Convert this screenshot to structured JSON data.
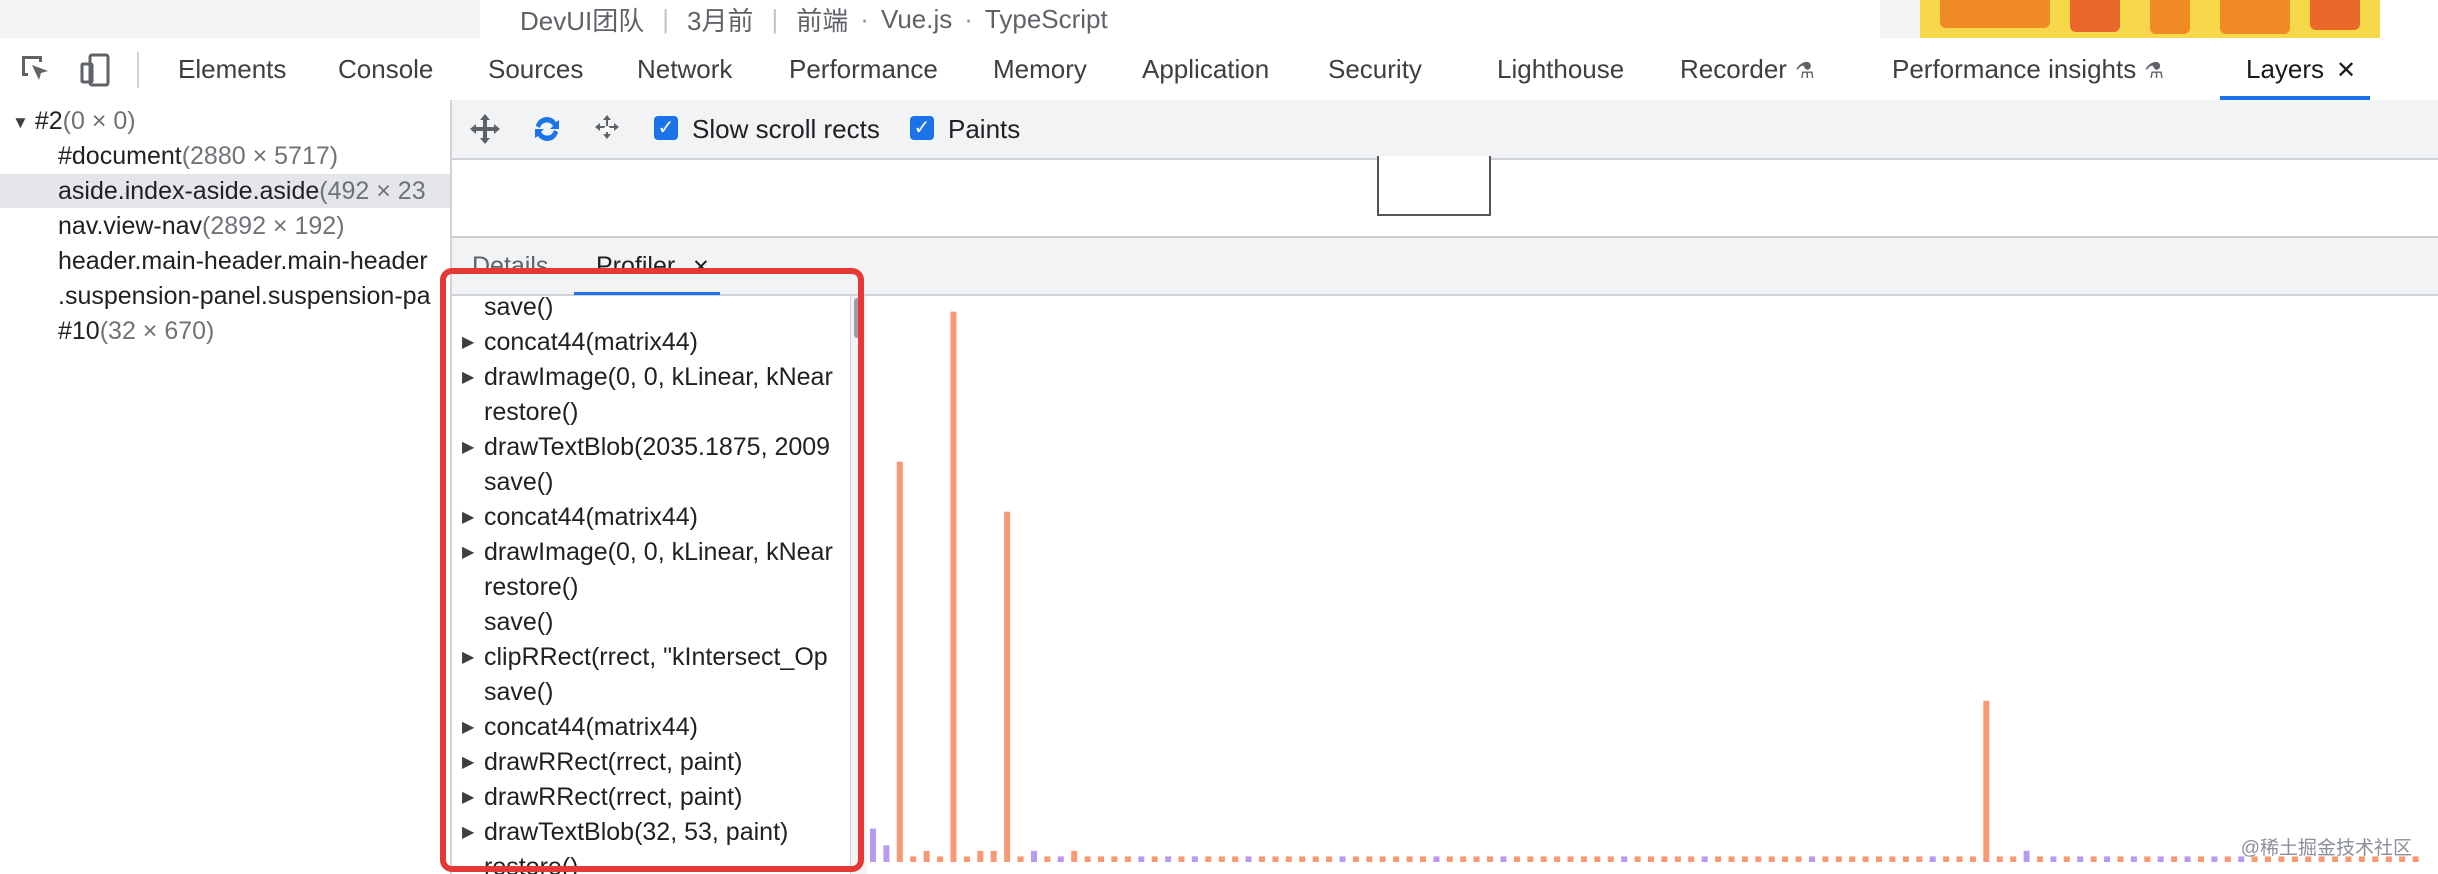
{
  "page_strip": {
    "author": "DevUI团队",
    "time_ago": "3月前",
    "category": "前端",
    "tag1": "Vue.js",
    "tag2": "TypeScript",
    "separator": "|",
    "dot": "·"
  },
  "toolbar": {
    "inspect_icon": "inspect-element-icon",
    "device_icon": "device-toggle-icon",
    "tabs": [
      {
        "label": "Elements"
      },
      {
        "label": "Console"
      },
      {
        "label": "Sources"
      },
      {
        "label": "Network"
      },
      {
        "label": "Performance"
      },
      {
        "label": "Memory"
      },
      {
        "label": "Application"
      },
      {
        "label": "Security"
      },
      {
        "label": "Lighthouse"
      },
      {
        "label": "Recorder",
        "experimental": true
      },
      {
        "label": "Performance insights",
        "experimental": true
      },
      {
        "label": "Layers",
        "active": true,
        "closable": true
      }
    ],
    "close_glyph": "✕",
    "flask_glyph": "⚗"
  },
  "layer_tree": {
    "rows": [
      {
        "name": "#2",
        "dims": "(0 × 0)",
        "expanded": true
      },
      {
        "name": "#document",
        "dims": "(2880 × 5717)"
      },
      {
        "name": "aside.index-aside.aside",
        "dims": "(492 × 23",
        "selected": true
      },
      {
        "name": "nav.view-nav",
        "dims": "(2892 × 192)"
      },
      {
        "name": "header.main-header.main-header",
        "dims": ""
      },
      {
        "name": ".suspension-panel.suspension-pa",
        "dims": ""
      },
      {
        "name": "#10",
        "dims": "(32 × 670)"
      }
    ]
  },
  "layers_toolbar": {
    "pan_icon": "pan-mode-icon",
    "rotate_icon": "rotate-mode-icon",
    "reset_icon": "reset-transform-icon",
    "slow_scroll_label": "Slow scroll rects",
    "slow_scroll_checked": true,
    "paints_label": "Paints",
    "paints_checked": true
  },
  "details_tabs": {
    "details": "Details",
    "profiler": "Profiler",
    "profiler_close": "✕"
  },
  "commands": [
    {
      "text": "save()",
      "expandable": false
    },
    {
      "text": "concat44(matrix44)",
      "expandable": true
    },
    {
      "text": "drawImage(0, 0, kLinear, kNear",
      "expandable": true
    },
    {
      "text": "restore()",
      "expandable": false
    },
    {
      "text": "drawTextBlob(2035.1875, 2009",
      "expandable": true
    },
    {
      "text": "save()",
      "expandable": false
    },
    {
      "text": "concat44(matrix44)",
      "expandable": true
    },
    {
      "text": "drawImage(0, 0, kLinear, kNear",
      "expandable": true
    },
    {
      "text": "restore()",
      "expandable": false
    },
    {
      "text": "save()",
      "expandable": false
    },
    {
      "text": "clipRRect(rrect, \"kIntersect_Op",
      "expandable": true
    },
    {
      "text": "save()",
      "expandable": false
    },
    {
      "text": "concat44(matrix44)",
      "expandable": true
    },
    {
      "text": "drawRRect(rrect, paint)",
      "expandable": true
    },
    {
      "text": "drawRRect(rrect, paint)",
      "expandable": true
    },
    {
      "text": "drawTextBlob(32, 53, paint)",
      "expandable": true
    },
    {
      "text": "restore()",
      "expandable": false
    }
  ],
  "chart_data": {
    "type": "bar",
    "colors": {
      "orange": "#f79a74",
      "purple": "#b89af2"
    },
    "ylim": [
      0,
      1
    ],
    "series": [
      {
        "values": [
          0.06,
          0.03,
          0.72,
          0.01,
          0.02,
          0.01,
          0.99,
          0.01,
          0.02,
          0.02,
          0.63,
          0.01,
          0.02,
          0.01,
          0.01,
          0.02,
          0.01,
          0.01,
          0.01,
          0.01,
          0.01,
          0.01,
          0.01,
          0.01,
          0.01,
          0.01,
          0.01,
          0.01,
          0.01,
          0.01,
          0.01,
          0.01,
          0.01,
          0.01,
          0.01,
          0.01,
          0.01,
          0.01,
          0.01,
          0.01,
          0.01,
          0.01,
          0.01,
          0.01,
          0.01,
          0.01,
          0.01,
          0.01,
          0.01,
          0.01,
          0.01,
          0.01,
          0.01,
          0.01,
          0.01,
          0.01,
          0.01,
          0.01,
          0.01,
          0.01,
          0.01,
          0.01,
          0.01,
          0.01,
          0.01,
          0.01,
          0.01,
          0.01,
          0.01,
          0.01,
          0.01,
          0.01,
          0.01,
          0.01,
          0.01,
          0.01,
          0.01,
          0.01,
          0.01,
          0.01,
          0.01,
          0.01,
          0.01,
          0.29,
          0.01,
          0.01,
          0.02,
          0.01,
          0.01,
          0.01,
          0.01,
          0.01,
          0.01,
          0.01,
          0.01,
          0.01,
          0.01,
          0.01,
          0.01,
          0.01,
          0.01,
          0.01,
          0.01,
          0.01,
          0.01,
          0.01,
          0.01,
          0.01,
          0.01,
          0.01,
          0.01,
          0.01,
          0.01,
          0.01,
          0.01,
          0.01
        ],
        "colors_idx": "mixed"
      }
    ]
  },
  "watermark": "@稀土掘金技术社区"
}
